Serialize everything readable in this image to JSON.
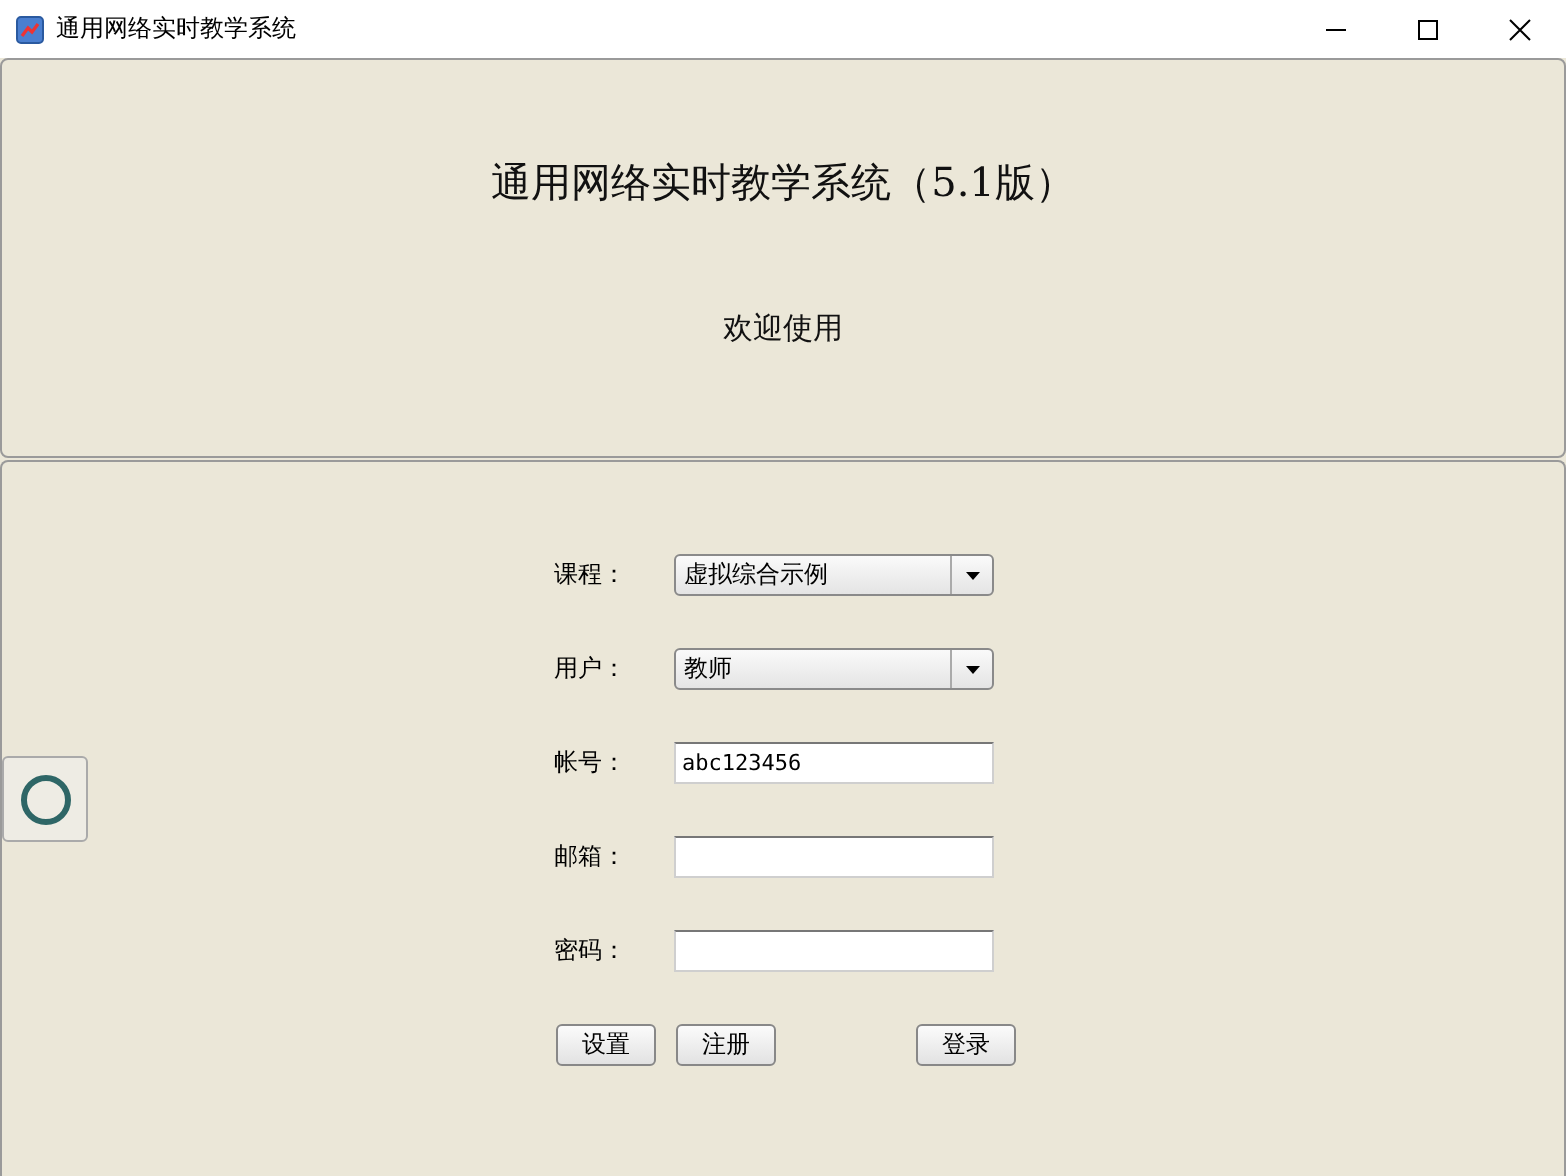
{
  "window": {
    "title": "通用网络实时教学系统"
  },
  "header": {
    "title": "通用网络实时教学系统（5.1版）",
    "subtitle": "欢迎使用"
  },
  "form": {
    "fields": [
      {
        "label": "课程：",
        "kind": "select",
        "value": "虚拟综合示例"
      },
      {
        "label": "用户：",
        "kind": "select",
        "value": "教师"
      },
      {
        "label": "帐号：",
        "kind": "text",
        "value": "abc123456"
      },
      {
        "label": "邮箱：",
        "kind": "text"
      },
      {
        "label": "密码：",
        "kind": "text"
      }
    ],
    "buttons": [
      "设置",
      "注册",
      "登录"
    ]
  }
}
